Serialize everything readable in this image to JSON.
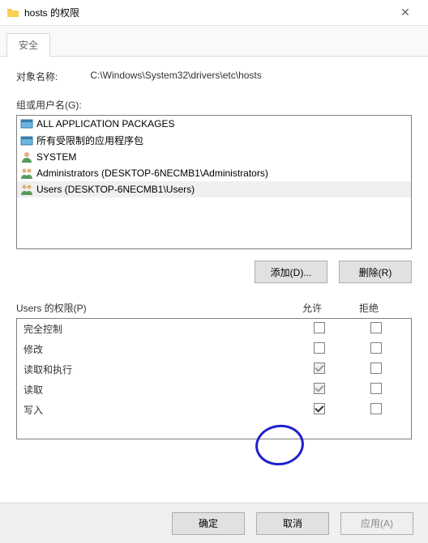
{
  "window": {
    "title": "hosts 的权限",
    "close_glyph": "✕"
  },
  "tabs": {
    "security": "安全"
  },
  "object": {
    "label": "对象名称:",
    "value": "C:\\Windows\\System32\\drivers\\etc\\hosts"
  },
  "groups": {
    "label": "组或用户名(G):",
    "items": [
      {
        "icon": "package",
        "name": "ALL APPLICATION PACKAGES"
      },
      {
        "icon": "package",
        "name": "所有受限制的应用程序包"
      },
      {
        "icon": "user",
        "name": "SYSTEM"
      },
      {
        "icon": "group",
        "name": "Administrators (DESKTOP-6NECMB1\\Administrators)"
      },
      {
        "icon": "group",
        "name": "Users (DESKTOP-6NECMB1\\Users)",
        "selected": true
      }
    ]
  },
  "buttons": {
    "add": "添加(D)...",
    "remove": "删除(R)",
    "ok": "确定",
    "cancel": "取消",
    "apply": "应用(A)"
  },
  "permissions": {
    "title": "Users 的权限(P)",
    "col_allow": "允许",
    "col_deny": "拒绝",
    "rows": [
      {
        "name": "完全控制",
        "allow": false,
        "deny": false,
        "allow_disabled": false
      },
      {
        "name": "修改",
        "allow": false,
        "deny": false,
        "allow_disabled": false
      },
      {
        "name": "读取和执行",
        "allow": true,
        "deny": false,
        "allow_disabled": true
      },
      {
        "name": "读取",
        "allow": true,
        "deny": false,
        "allow_disabled": true
      },
      {
        "name": "写入",
        "allow": true,
        "deny": false,
        "allow_disabled": false
      }
    ]
  }
}
